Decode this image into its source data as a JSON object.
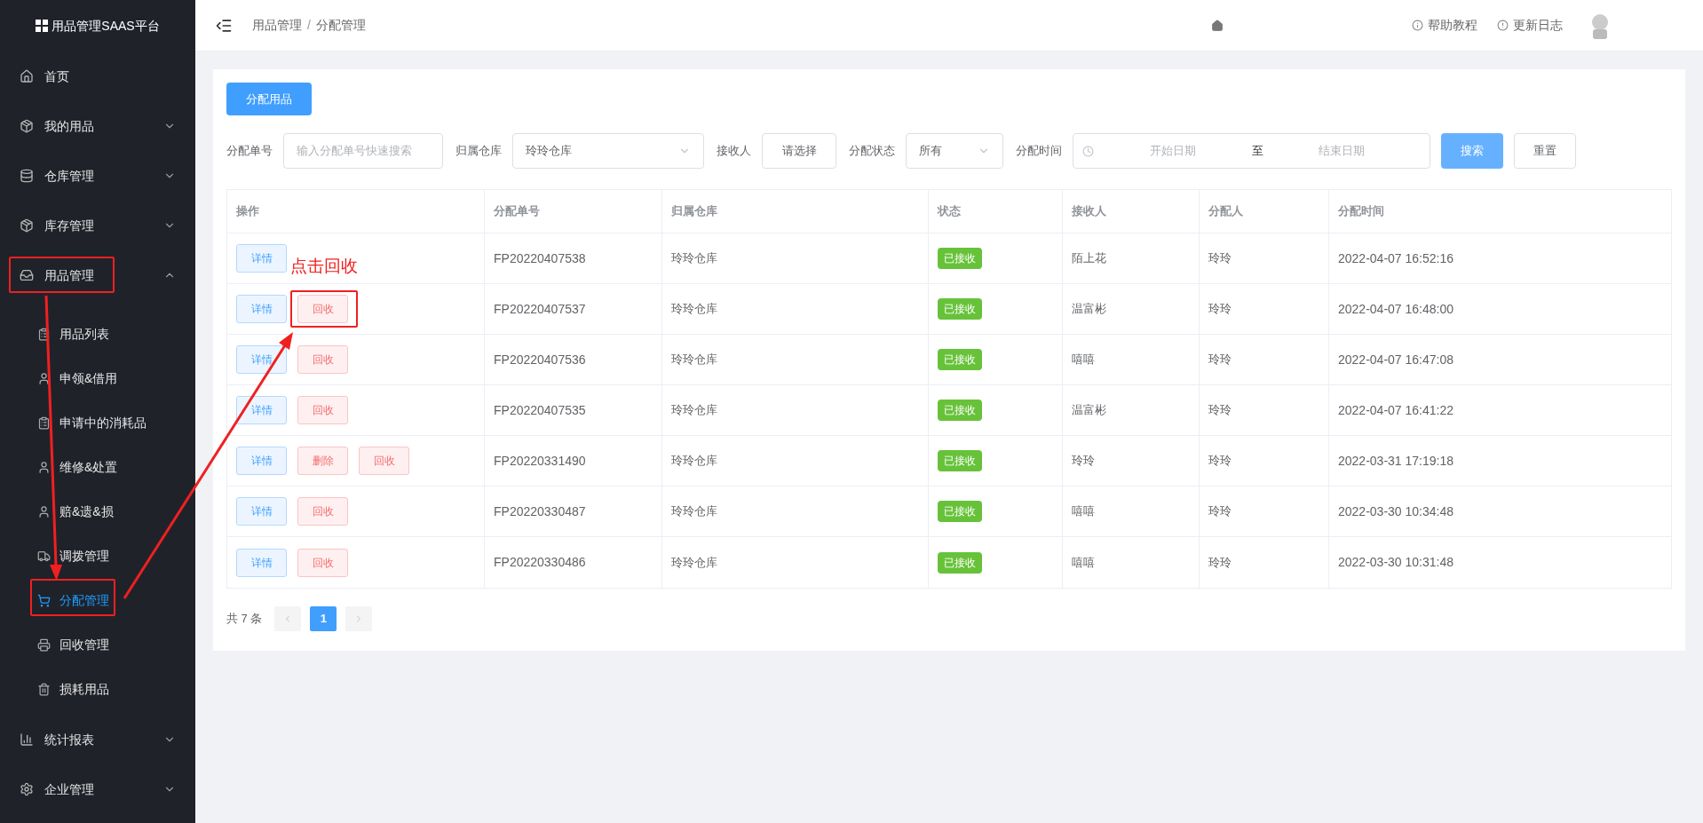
{
  "sidebar": {
    "logo": "用品管理SAAS平台",
    "items": [
      {
        "label": "首页"
      },
      {
        "label": "我的用品",
        "expanded": false
      },
      {
        "label": "仓库管理",
        "expanded": false
      },
      {
        "label": "库存管理",
        "expanded": false
      },
      {
        "label": "用品管理",
        "expanded": true,
        "children": [
          {
            "label": "用品列表",
            "selected": false
          },
          {
            "label": "申领&借用",
            "selected": false
          },
          {
            "label": "申请中的消耗品",
            "selected": false
          },
          {
            "label": "维修&处置",
            "selected": false
          },
          {
            "label": "赔&遗&损",
            "selected": false
          },
          {
            "label": "调拨管理",
            "selected": false
          },
          {
            "label": "分配管理",
            "selected": true
          },
          {
            "label": "回收管理",
            "selected": false
          },
          {
            "label": "损耗用品",
            "selected": false
          }
        ]
      },
      {
        "label": "统计报表",
        "expanded": false
      },
      {
        "label": "企业管理",
        "expanded": false
      }
    ]
  },
  "header": {
    "breadcrumb": [
      "用品管理",
      "分配管理"
    ],
    "breadcrumb_separator": "/",
    "links": [
      {
        "label": "帮助教程",
        "kind": "info"
      },
      {
        "label": "更新日志",
        "kind": "alert"
      }
    ]
  },
  "primary_button": "分配用品",
  "filters": [
    {
      "kind": "input",
      "label": "分配单号",
      "placeholder": "输入分配单号快速搜索"
    },
    {
      "kind": "select",
      "label": "归属仓库",
      "value": "玲玲仓库"
    },
    {
      "kind": "button",
      "label": "接收人",
      "value": "请选择"
    },
    {
      "kind": "select",
      "label": "分配状态",
      "value": "所有"
    },
    {
      "kind": "daterange",
      "label": "分配时间",
      "start": "开始日期",
      "separator": "至",
      "end": "结束日期"
    }
  ],
  "search_button": "搜索",
  "reset_button": "重置",
  "table": {
    "columns": [
      "操作",
      "分配单号",
      "归属仓库",
      "状态",
      "接收人",
      "分配人",
      "分配时间"
    ],
    "rows": [
      {
        "actions": [
          {
            "label": "详情",
            "kind": "detail"
          }
        ],
        "number": "FP20220407538",
        "warehouse": "玲玲仓库",
        "status": {
          "label": "已接收",
          "kind": "received"
        },
        "receiver": "陌上花",
        "assigner": "玲玲",
        "time": "2022-04-07 16:52:16"
      },
      {
        "actions": [
          {
            "label": "详情",
            "kind": "detail"
          },
          {
            "label": "回收",
            "kind": "recycle"
          }
        ],
        "number": "FP20220407537",
        "warehouse": "玲玲仓库",
        "status": {
          "label": "已接收",
          "kind": "received"
        },
        "receiver": "温富彬",
        "assigner": "玲玲",
        "time": "2022-04-07 16:48:00"
      },
      {
        "actions": [
          {
            "label": "详情",
            "kind": "detail"
          },
          {
            "label": "回收",
            "kind": "recycle"
          }
        ],
        "number": "FP20220407536",
        "warehouse": "玲玲仓库",
        "status": {
          "label": "已接收",
          "kind": "received"
        },
        "receiver": "嘻嘻",
        "assigner": "玲玲",
        "time": "2022-04-07 16:47:08"
      },
      {
        "actions": [
          {
            "label": "详情",
            "kind": "detail"
          },
          {
            "label": "回收",
            "kind": "recycle"
          }
        ],
        "number": "FP20220407535",
        "warehouse": "玲玲仓库",
        "status": {
          "label": "已接收",
          "kind": "received"
        },
        "receiver": "温富彬",
        "assigner": "玲玲",
        "time": "2022-04-07 16:41:22"
      },
      {
        "actions": [
          {
            "label": "详情",
            "kind": "detail"
          },
          {
            "label": "删除",
            "kind": "delete"
          },
          {
            "label": "回收",
            "kind": "recycle"
          }
        ],
        "number": "FP20220331490",
        "warehouse": "玲玲仓库",
        "status": {
          "label": "已接收",
          "kind": "received"
        },
        "receiver": "玲玲",
        "assigner": "玲玲",
        "time": "2022-03-31 17:19:18"
      },
      {
        "actions": [
          {
            "label": "详情",
            "kind": "detail"
          },
          {
            "label": "回收",
            "kind": "recycle"
          }
        ],
        "number": "FP20220330487",
        "warehouse": "玲玲仓库",
        "status": {
          "label": "已接收",
          "kind": "received"
        },
        "receiver": "嘻嘻",
        "assigner": "玲玲",
        "time": "2022-03-30 10:34:48"
      },
      {
        "actions": [
          {
            "label": "详情",
            "kind": "detail"
          },
          {
            "label": "回收",
            "kind": "recycle"
          }
        ],
        "number": "FP20220330486",
        "warehouse": "玲玲仓库",
        "status": {
          "label": "已接收",
          "kind": "received"
        },
        "receiver": "嘻嘻",
        "assigner": "玲玲",
        "time": "2022-03-30 10:31:48"
      }
    ]
  },
  "pagination": {
    "total": "共 7 条",
    "pages": [
      {
        "label": "1",
        "selected": true
      }
    ]
  },
  "annotation": {
    "label": "点击回收"
  }
}
